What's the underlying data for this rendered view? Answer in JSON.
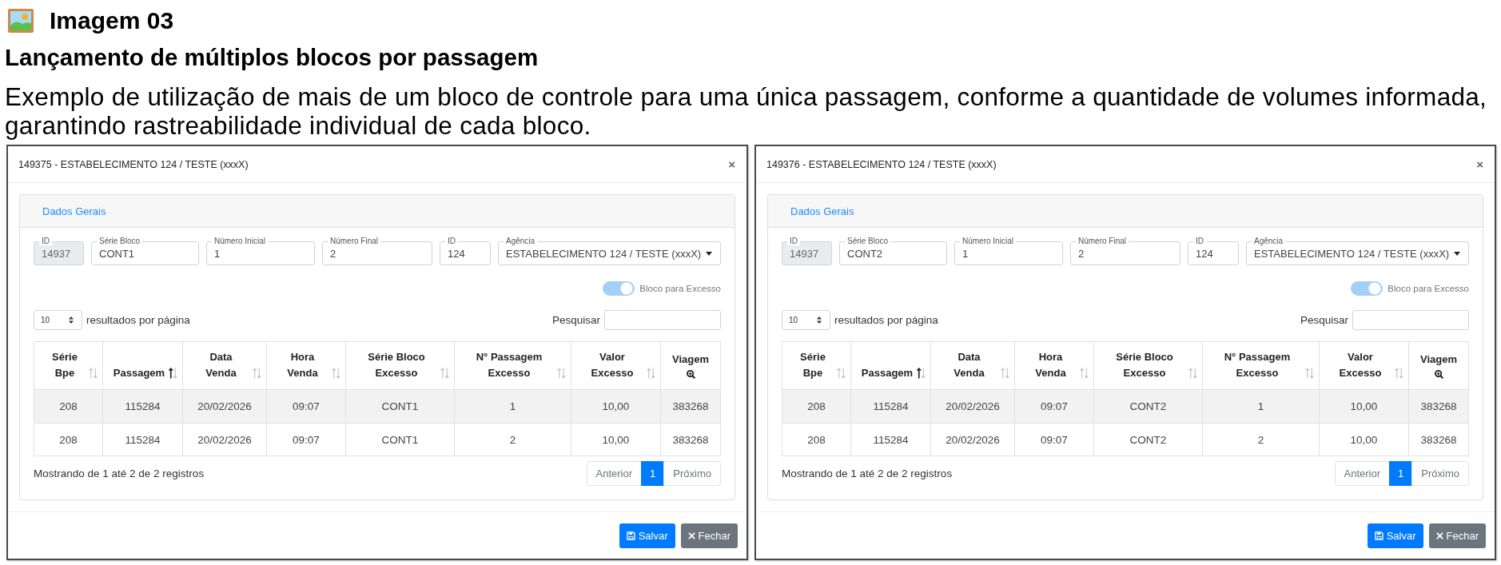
{
  "header": {
    "title": "Imagem 03",
    "subtitle": "Lançamento de múltiplos blocos por passagem",
    "description": "Exemplo de utilização de mais de um bloco de controle para uma única passagem, conforme a quantidade de volumes informada, garantindo rastreabilidade individual de cada bloco."
  },
  "dialogs": [
    {
      "title": "149375 - ESTABELECIMENTO 124 / TESTE (xxxX)",
      "close_label": "×",
      "section": "Dados Gerais",
      "fields": [
        {
          "kind": "text",
          "label": "ID",
          "value": "14937",
          "disabled": true
        },
        {
          "kind": "text",
          "label": "Série Bloco",
          "value": "CONT1",
          "disabled": false
        },
        {
          "kind": "text",
          "label": "Número Inicial",
          "value": "1",
          "disabled": false
        },
        {
          "kind": "text",
          "label": "Número Final",
          "value": "2",
          "disabled": false
        },
        {
          "kind": "text",
          "label": "ID",
          "value": "124",
          "disabled": false
        },
        {
          "kind": "select",
          "label": "Agência",
          "value": "ESTABELECIMENTO 124 / TESTE (xxxX)",
          "disabled": false
        }
      ],
      "toggle": {
        "label": "Bloco para Excesso",
        "on": true,
        "disabled": true
      },
      "page_length": {
        "value": "10",
        "label": "resultados por página"
      },
      "search": {
        "label": "Pesquisar"
      },
      "table": {
        "columns": [
          {
            "label": "Série\nBpe",
            "kind": "sortable",
            "sorted": false
          },
          {
            "label": "Passagem",
            "kind": "sortable",
            "sorted": true
          },
          {
            "label": "Data\nVenda",
            "kind": "sortable",
            "sorted": false
          },
          {
            "label": "Hora\nVenda",
            "kind": "sortable",
            "sorted": false
          },
          {
            "label": "Série Bloco\nExcesso",
            "kind": "sortable",
            "sorted": false
          },
          {
            "label": "N° Passagem\nExcesso",
            "kind": "sortable",
            "sorted": false
          },
          {
            "label": "Valor\nExcesso",
            "kind": "sortable",
            "sorted": false
          },
          {
            "label": "Viagem",
            "kind": "lookup"
          }
        ],
        "rows": [
          [
            "208",
            "115284",
            "20/02/2026",
            "09:07",
            "CONT1",
            "1",
            "10,00",
            "383268"
          ],
          [
            "208",
            "115284",
            "20/02/2026",
            "09:07",
            "CONT1",
            "2",
            "10,00",
            "383268"
          ]
        ]
      },
      "info": "Mostrando de 1 até 2 de 2 registros",
      "pagination": [
        {
          "label": "Anterior",
          "selected": false,
          "disabled": true
        },
        {
          "label": "1",
          "selected": true,
          "disabled": false
        },
        {
          "label": "Próximo",
          "selected": false,
          "disabled": true
        }
      ],
      "buttons": [
        {
          "label": "Salvar",
          "kind": "primary"
        },
        {
          "label": "Fechar",
          "kind": "secondary"
        }
      ]
    },
    {
      "title": "149376 - ESTABELECIMENTO 124 / TESTE (xxxX)",
      "close_label": "×",
      "section": "Dados Gerais",
      "fields": [
        {
          "kind": "text",
          "label": "ID",
          "value": "14937",
          "disabled": true
        },
        {
          "kind": "text",
          "label": "Série Bloco",
          "value": "CONT2",
          "disabled": false
        },
        {
          "kind": "text",
          "label": "Número Inicial",
          "value": "1",
          "disabled": false
        },
        {
          "kind": "text",
          "label": "Número Final",
          "value": "2",
          "disabled": false
        },
        {
          "kind": "text",
          "label": "ID",
          "value": "124",
          "disabled": false
        },
        {
          "kind": "select",
          "label": "Agência",
          "value": "ESTABELECIMENTO 124 / TESTE (xxxX)",
          "disabled": false
        }
      ],
      "toggle": {
        "label": "Bloco para Excesso",
        "on": true,
        "disabled": true
      },
      "page_length": {
        "value": "10",
        "label": "resultados por página"
      },
      "search": {
        "label": "Pesquisar"
      },
      "table": {
        "columns": [
          {
            "label": "Série\nBpe",
            "kind": "sortable",
            "sorted": false
          },
          {
            "label": "Passagem",
            "kind": "sortable",
            "sorted": true
          },
          {
            "label": "Data\nVenda",
            "kind": "sortable",
            "sorted": false
          },
          {
            "label": "Hora\nVenda",
            "kind": "sortable",
            "sorted": false
          },
          {
            "label": "Série Bloco\nExcesso",
            "kind": "sortable",
            "sorted": false
          },
          {
            "label": "N° Passagem\nExcesso",
            "kind": "sortable",
            "sorted": false
          },
          {
            "label": "Valor\nExcesso",
            "kind": "sortable",
            "sorted": false
          },
          {
            "label": "Viagem",
            "kind": "lookup"
          }
        ],
        "rows": [
          [
            "208",
            "115284",
            "20/02/2026",
            "09:07",
            "CONT2",
            "1",
            "10,00",
            "383268"
          ],
          [
            "208",
            "115284",
            "20/02/2026",
            "09:07",
            "CONT2",
            "2",
            "10,00",
            "383268"
          ]
        ]
      },
      "info": "Mostrando de 1 até 2 de 2 registros",
      "pagination": [
        {
          "label": "Anterior",
          "selected": false,
          "disabled": true
        },
        {
          "label": "1",
          "selected": true,
          "disabled": false
        },
        {
          "label": "Próximo",
          "selected": false,
          "disabled": true
        }
      ],
      "buttons": [
        {
          "label": "Salvar",
          "kind": "primary"
        },
        {
          "label": "Fechar",
          "kind": "secondary"
        }
      ]
    }
  ]
}
